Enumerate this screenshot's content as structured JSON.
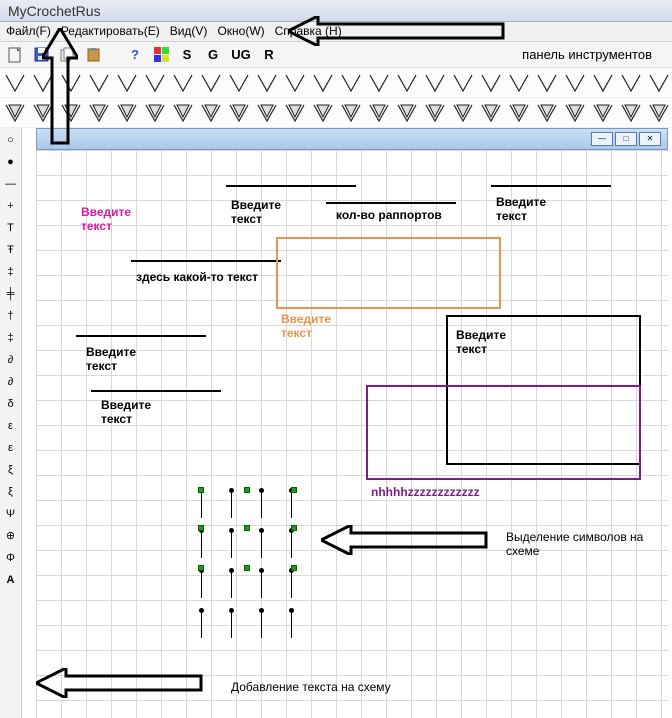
{
  "title": "MyCrochetRus",
  "menu": [
    "Файл(F)",
    "Редактировать(E)",
    "Вид(V)",
    "Окно(W)",
    "Справка (H)"
  ],
  "toolbar_letters": [
    "S",
    "G",
    "UG",
    "R"
  ],
  "toolbar_label": "панель инструментов",
  "canvas": {
    "text_magenta": "Введите текст",
    "t1": "Введите текст",
    "t2": "кол-во раппортов",
    "t3": "Введите текст",
    "t4": "здесь какой-то текст",
    "t5": "Введите текст",
    "t6": "Введите текст",
    "t7": "Введите текст",
    "t8": "Введите текст",
    "t9": "nhhhhzzzzzzzzzzzz",
    "ann1": "Выделение символов на схеме",
    "ann2": "Добавление текста на схему"
  },
  "boxes": {
    "orange": {
      "color": "#e8954b"
    },
    "black": {
      "color": "#000000"
    },
    "purple": {
      "color": "#801b8e"
    }
  }
}
